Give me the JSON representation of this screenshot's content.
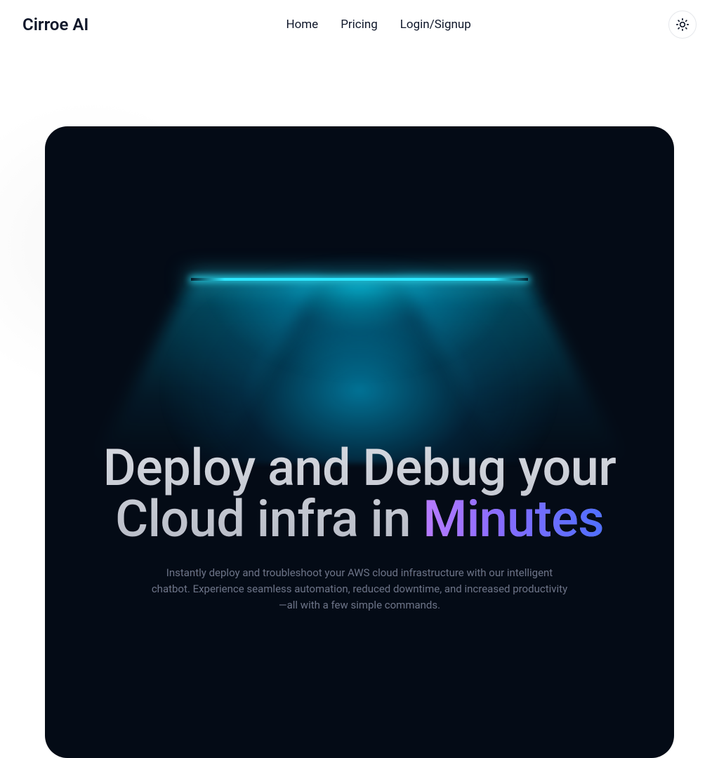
{
  "header": {
    "logo": "Cirroe AI",
    "nav": {
      "home": "Home",
      "pricing": "Pricing",
      "login": "Login/Signup"
    }
  },
  "hero": {
    "headline_pre": "Deploy and Debug your Cloud infra in ",
    "headline_accent": "Minutes",
    "subcopy": "Instantly deploy and troubleshoot your AWS cloud infrastructure with our intelligent chatbot. Experience seamless automation, reduced downtime, and increased productivity—all with a few simple commands."
  }
}
